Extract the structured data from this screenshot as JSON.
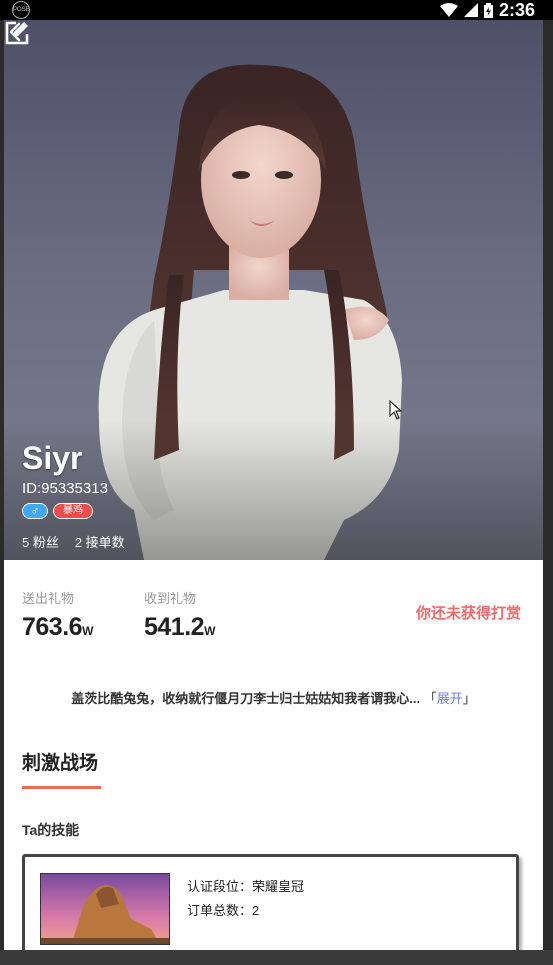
{
  "statusbar": {
    "time": "2:36",
    "logo": "POSE"
  },
  "header": {
    "back_icon": "chevron-left-icon",
    "edit_icon": "edit-icon"
  },
  "profile": {
    "name": "Siyr",
    "id_text": "ID:95335313",
    "gender_symbol": "♂",
    "tag": "暴鸡",
    "fans": "5 粉丝",
    "orders": "2 接单数"
  },
  "stats": {
    "sent_label": "送出礼物",
    "sent_value": "763.6",
    "sent_unit": "W",
    "received_label": "收到礼物",
    "received_value": "541.2",
    "received_unit": "W",
    "reward_text": "你还未获得打赏"
  },
  "bio": {
    "text": "盖茨比酷兔兔，收纳就行偃月刀李士归士姑姑知我者谓我心...",
    "open_bracket": "「",
    "expand": "展开",
    "close_bracket": "」"
  },
  "section": {
    "title": "刺激战场"
  },
  "skills": {
    "label": "Ta的技能",
    "card": {
      "rank": "认证段位：荣耀皇冠",
      "orders": "订单总数：2"
    }
  },
  "colors": {
    "accent_red": "#f06a6a",
    "underline": "#f06a50",
    "link_blue": "#6a7fd8",
    "gender_blue": "#3fa9f5",
    "tag_red": "#f04b4b"
  }
}
